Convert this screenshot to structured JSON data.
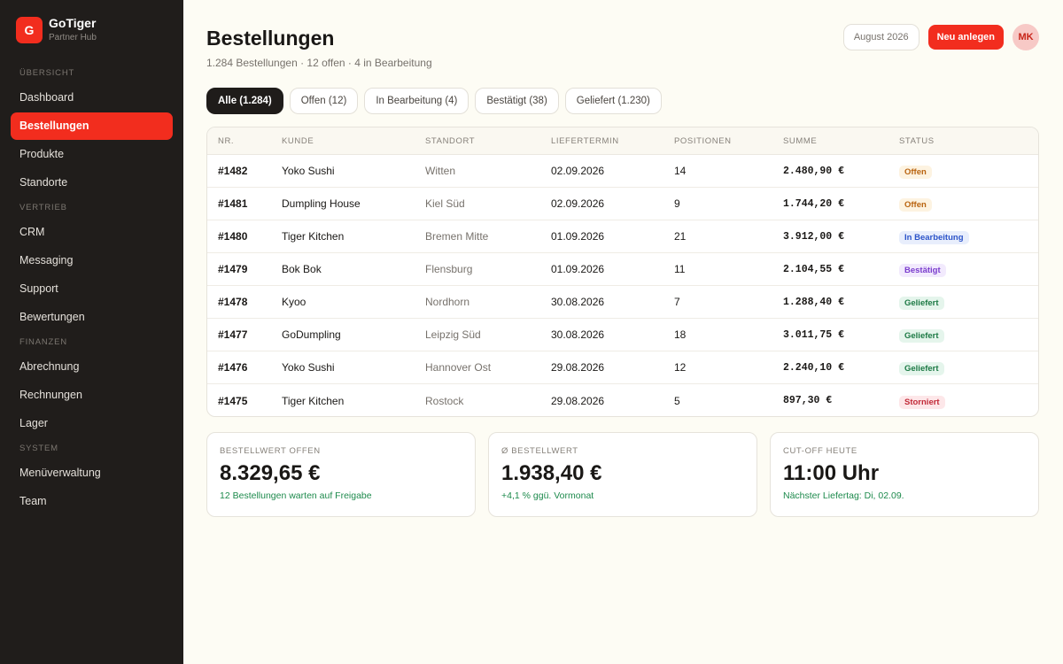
{
  "brand": {
    "logo": "G",
    "name": "GoTiger",
    "sub": "Partner Hub"
  },
  "nav": {
    "sections": [
      {
        "title": "ÜBERSICHT",
        "items": [
          "Dashboard",
          "Bestellungen",
          "Produkte",
          "Standorte"
        ]
      },
      {
        "title": "VERTRIEB",
        "items": [
          "CRM",
          "Messaging",
          "Support",
          "Bewertungen"
        ]
      },
      {
        "title": "FINANZEN",
        "items": [
          "Abrechnung",
          "Rechnungen",
          "Lager"
        ]
      },
      {
        "title": "SYSTEM",
        "items": [
          "Menüverwaltung",
          "Team"
        ]
      }
    ],
    "active": "Bestellungen"
  },
  "header": {
    "title": "Bestellungen",
    "subtitle": "1.284 Bestellungen · 12 offen · 4 in Bearbeitung",
    "month": "August 2026",
    "new_label": "Neu anlegen",
    "avatar": "MK"
  },
  "tabs": [
    {
      "label": "Alle (1.284)",
      "active": true
    },
    {
      "label": "Offen (12)",
      "active": false
    },
    {
      "label": "In Bearbeitung (4)",
      "active": false
    },
    {
      "label": "Bestätigt (38)",
      "active": false
    },
    {
      "label": "Geliefert (1.230)",
      "active": false
    }
  ],
  "table": {
    "columns": [
      "NR.",
      "KUNDE",
      "STANDORT",
      "LIEFERTERMIN",
      "POSITIONEN",
      "SUMME",
      "STATUS"
    ],
    "rows": [
      {
        "nr": "#1482",
        "kunde": "Yoko Sushi",
        "standort": "Witten",
        "termin": "02.09.2026",
        "positionen": "14",
        "summe": "2.480,90 €",
        "status": "Offen",
        "status_type": "offen"
      },
      {
        "nr": "#1481",
        "kunde": "Dumpling House",
        "standort": "Kiel Süd",
        "termin": "02.09.2026",
        "positionen": "9",
        "summe": "1.744,20 €",
        "status": "Offen",
        "status_type": "offen"
      },
      {
        "nr": "#1480",
        "kunde": "Tiger Kitchen",
        "standort": "Bremen Mitte",
        "termin": "01.09.2026",
        "positionen": "21",
        "summe": "3.912,00 €",
        "status": "In Bearbeitung",
        "status_type": "bearbeitung"
      },
      {
        "nr": "#1479",
        "kunde": "Bok Bok",
        "standort": "Flensburg",
        "termin": "01.09.2026",
        "positionen": "11",
        "summe": "2.104,55 €",
        "status": "Bestätigt",
        "status_type": "bestaetigt"
      },
      {
        "nr": "#1478",
        "kunde": "Kyoo",
        "standort": "Nordhorn",
        "termin": "30.08.2026",
        "positionen": "7",
        "summe": "1.288,40 €",
        "status": "Geliefert",
        "status_type": "geliefert"
      },
      {
        "nr": "#1477",
        "kunde": "GoDumpling",
        "standort": "Leipzig Süd",
        "termin": "30.08.2026",
        "positionen": "18",
        "summe": "3.011,75 €",
        "status": "Geliefert",
        "status_type": "geliefert"
      },
      {
        "nr": "#1476",
        "kunde": "Yoko Sushi",
        "standort": "Hannover Ost",
        "termin": "29.08.2026",
        "positionen": "12",
        "summe": "2.240,10 €",
        "status": "Geliefert",
        "status_type": "geliefert"
      },
      {
        "nr": "#1475",
        "kunde": "Tiger Kitchen",
        "standort": "Rostock",
        "termin": "29.08.2026",
        "positionen": "5",
        "summe": "897,30 €",
        "status": "Storniert",
        "status_type": "storniert"
      }
    ]
  },
  "stats": [
    {
      "label": "BESTELLWERT OFFEN",
      "value": "8.329,65 €",
      "note": "12 Bestellungen warten auf Freigabe"
    },
    {
      "label": "Ø BESTELLWERT",
      "value": "1.938,40 €",
      "note": "+4,1 % ggü. Vormonat"
    },
    {
      "label": "CUT-OFF HEUTE",
      "value": "11:00 Uhr",
      "note": "Nächster Liefertag: Di, 02.09."
    }
  ],
  "colors": {
    "accent": "#f22d1e",
    "sidebar": "#201d1b",
    "background": "#fdfcf4"
  }
}
